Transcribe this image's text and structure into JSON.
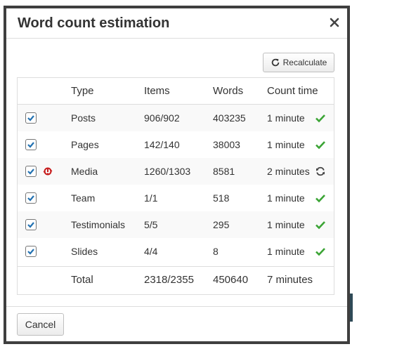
{
  "dialog": {
    "title": "Word count estimation",
    "close_icon": "close-icon",
    "recalculate_label": "Recalculate",
    "cancel_label": "Cancel"
  },
  "colors": {
    "check_green": "#3ba435",
    "checkbox_blue": "#2271b1",
    "warning_red": "#c71c1c"
  },
  "table": {
    "headers": {
      "type": "Type",
      "items": "Items",
      "words": "Words",
      "count_time": "Count time"
    },
    "rows": [
      {
        "checked": true,
        "type": "Posts",
        "items": "906/902",
        "words": "403235",
        "time": "1 minute",
        "status": "check-icon"
      },
      {
        "checked": true,
        "type": "Pages",
        "items": "142/140",
        "words": "38003",
        "time": "1 minute",
        "status": "check-icon"
      },
      {
        "checked": true,
        "type": "Media",
        "items": "1260/1303",
        "words": "8581",
        "time": "2 minutes",
        "status": "refresh-icon",
        "warning": "warning-icon"
      },
      {
        "checked": true,
        "type": "Team",
        "items": "1/1",
        "words": "518",
        "time": "1 minute",
        "status": "check-icon"
      },
      {
        "checked": true,
        "type": "Testimonials",
        "items": "5/5",
        "words": "295",
        "time": "1 minute",
        "status": "check-icon"
      },
      {
        "checked": true,
        "type": "Slides",
        "items": "4/4",
        "words": "8",
        "time": "1 minute",
        "status": "check-icon"
      }
    ],
    "total": {
      "type": "Total",
      "items": "2318/2355",
      "words": "450640",
      "time": "7 minutes"
    }
  }
}
